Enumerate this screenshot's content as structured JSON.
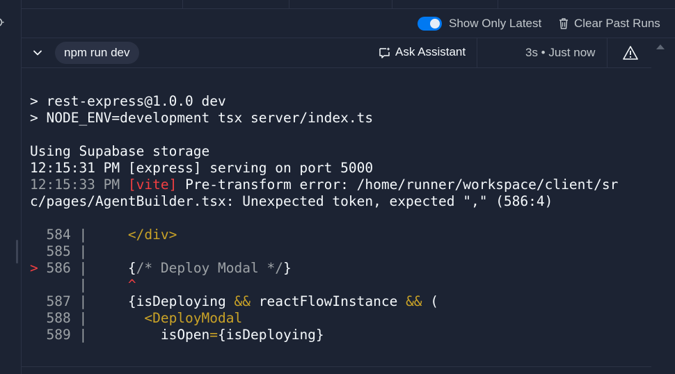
{
  "colors": {
    "background": "#1c2333",
    "border": "#2b3245",
    "toggle_on": "#0079f2",
    "error_red": "#f23f42",
    "tag_yellow": "#c9a227",
    "muted": "#9da2a6"
  },
  "toolbar": {
    "show_only_latest_label": "Show Only Latest",
    "show_only_latest_on": true,
    "clear_past_runs_label": "Clear Past Runs"
  },
  "run": {
    "command": "npm run dev",
    "ask_assistant_label": "Ask Assistant",
    "status": "3s • Just now"
  },
  "icons": {
    "gear": "gear-icon",
    "trash": "trash-icon",
    "chevron": "chevron-down-icon",
    "assistant": "assistant-chat-icon",
    "warning": "warning-icon",
    "scroll_up": "scroll-up-icon"
  },
  "console": {
    "npm_line1": "> rest-express@1.0.0 dev",
    "npm_line2": "> NODE_ENV=development tsx server/index.ts",
    "storage": "Using Supabase storage",
    "express_line": "12:15:31 PM [express] serving on port 5000",
    "vite_time": "12:15:33 PM ",
    "vite_tag": "[vite]",
    "vite_msg": " Pre-transform error: /home/runner/workspace/client/sr",
    "vite_msg2": "c/pages/AgentBuilder.tsx: Unexpected token, expected \",\" (586:4)",
    "code": {
      "l584_num": "  584 | ",
      "l584_code": "    </div>",
      "l585_num": "  585 |",
      "l586_arrow": "> ",
      "l586_num": "586 | ",
      "l586_brace_open": "    {",
      "l586_comment": "/* Deploy Modal */",
      "l586_brace_close": "}",
      "caret_gutter": "      | ",
      "caret_mark": "    ^",
      "l587_num": "  587 | ",
      "l587_a": "    {isDeploying ",
      "l587_op1": "&&",
      "l587_b": " reactFlowInstance ",
      "l587_op2": "&&",
      "l587_c": " (",
      "l588_num": "  588 | ",
      "l588_code": "      <DeployModal",
      "l589_num": "  589 | ",
      "l589_a": "        isOpen",
      "l589_eq": "=",
      "l589_b": "{isDeploying}"
    }
  }
}
